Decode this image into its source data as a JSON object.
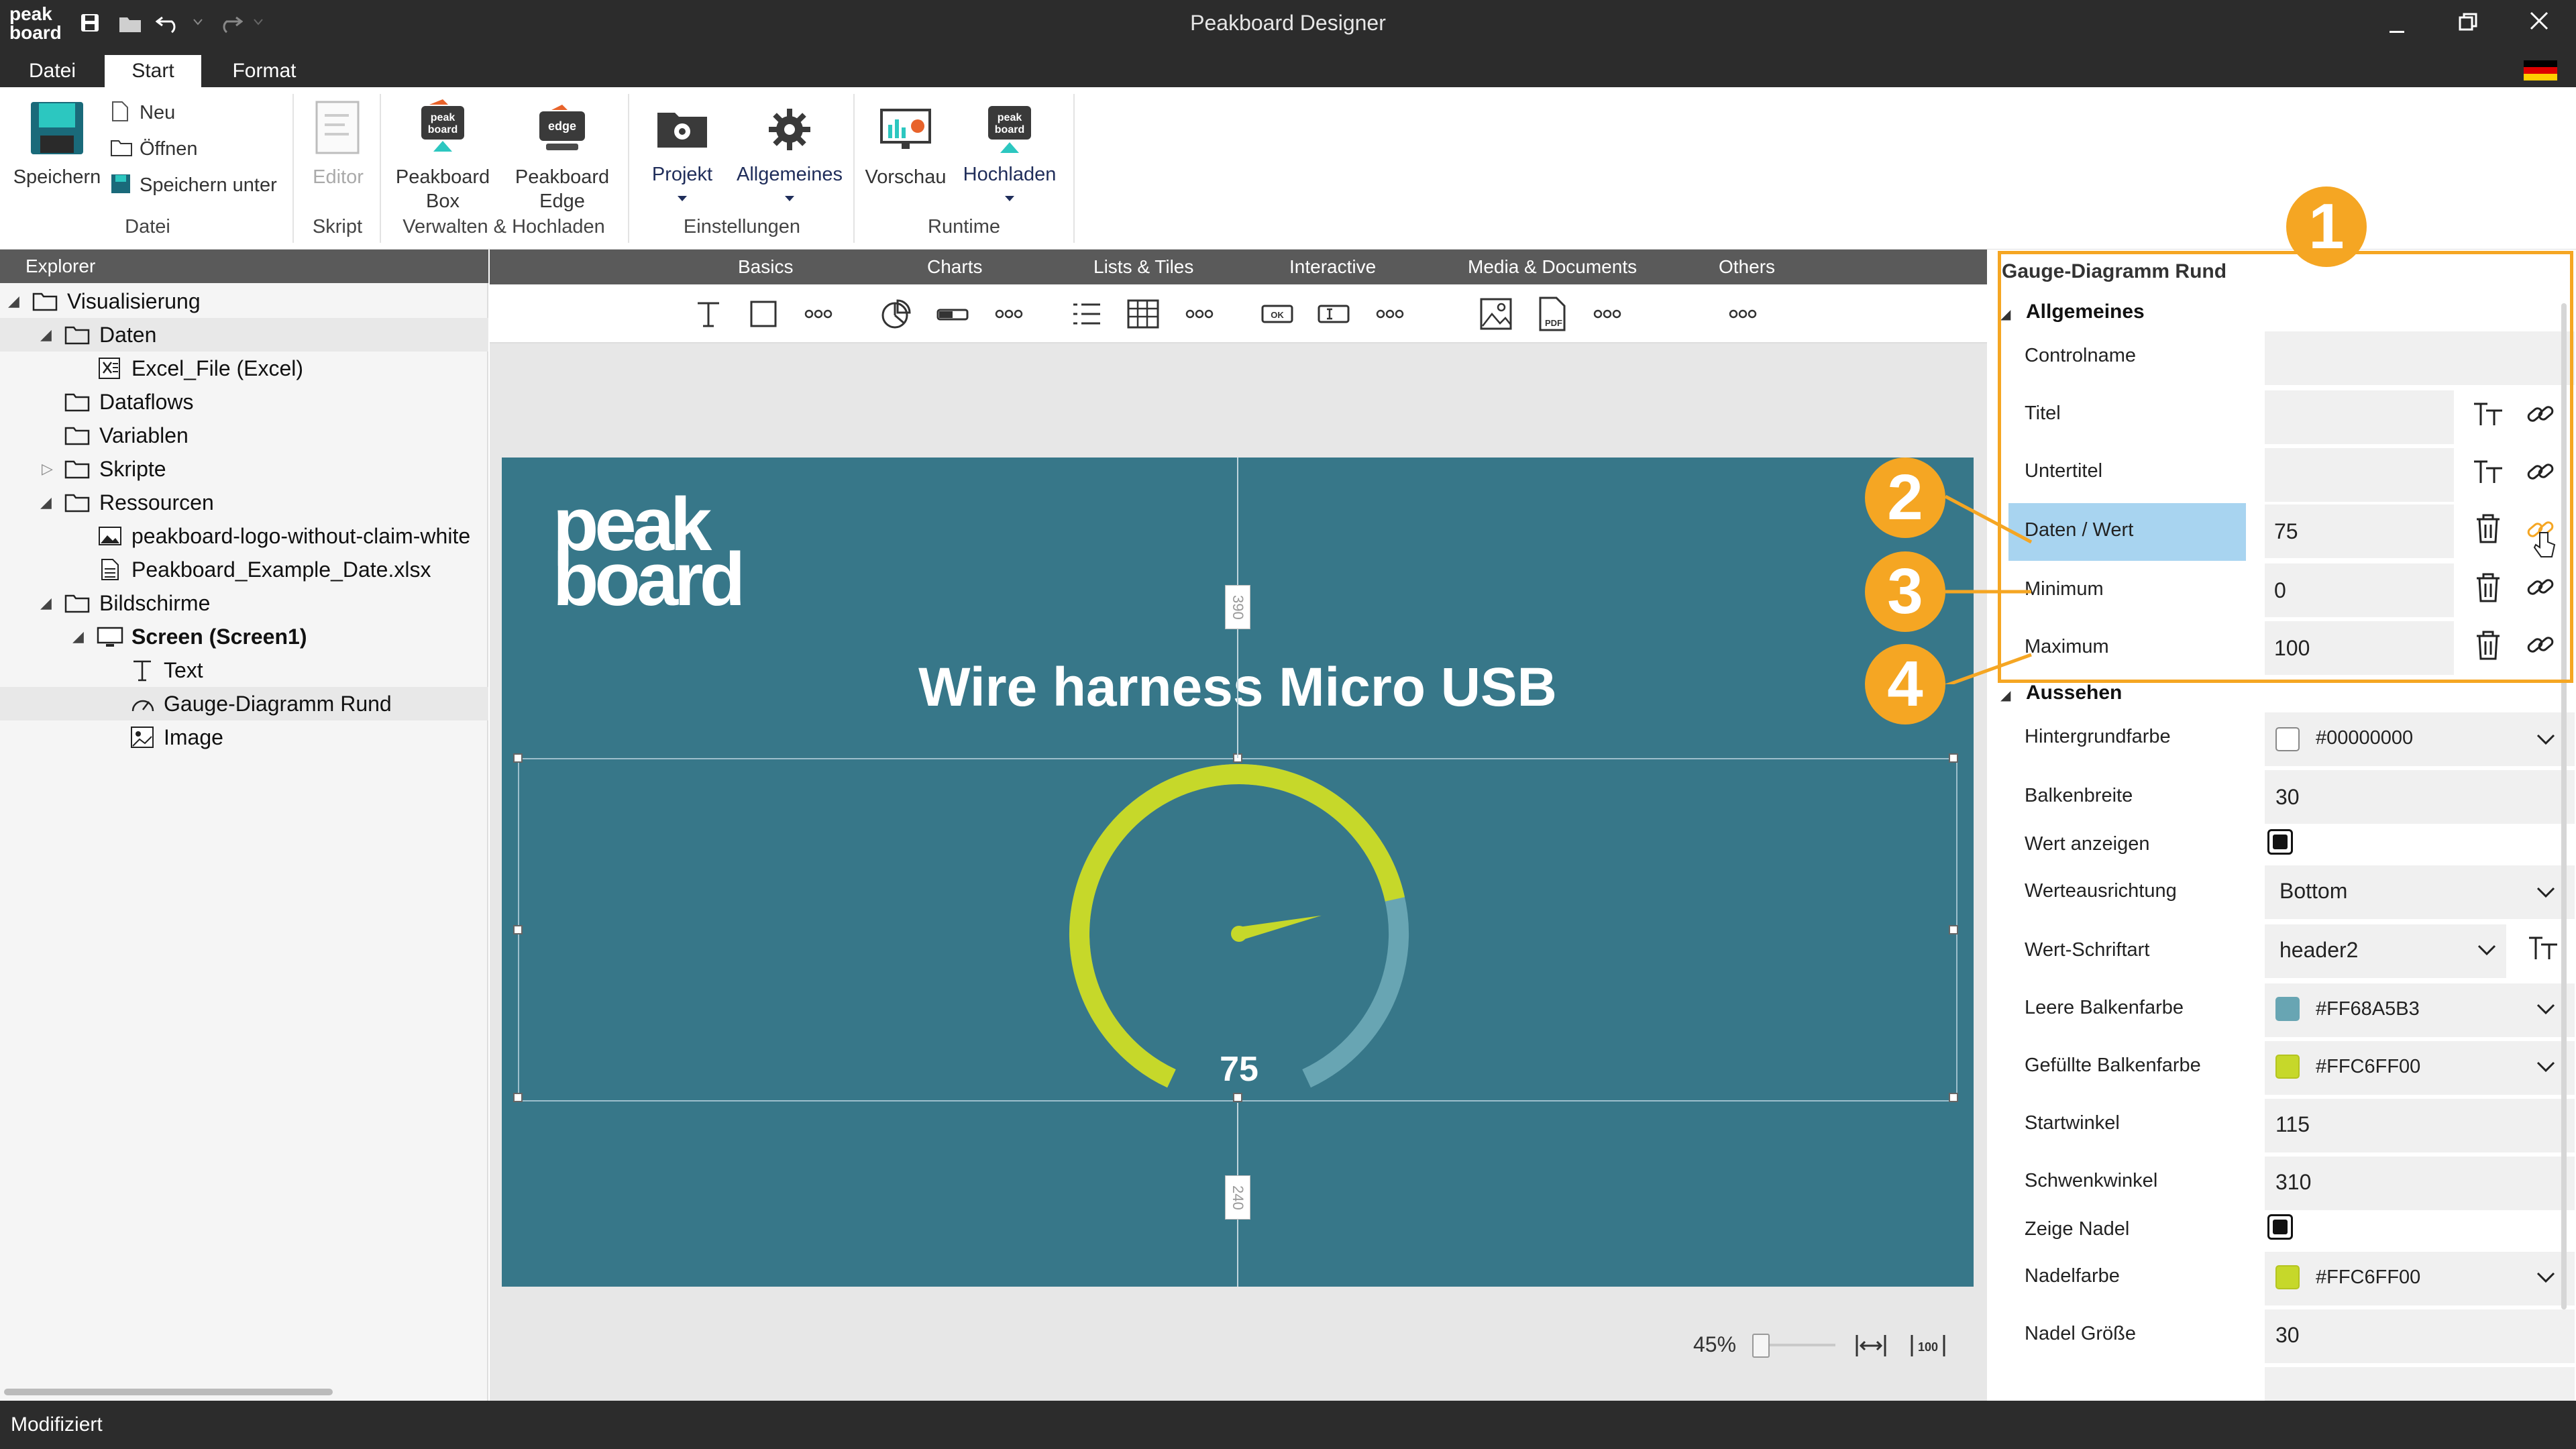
{
  "window": {
    "title": "Peakboard Designer",
    "logo_text": "peak board",
    "flag": "german-flag"
  },
  "menu": {
    "tabs": [
      "Datei",
      "Start",
      "Format"
    ],
    "active": "Start"
  },
  "ribbon": {
    "save": "Speichern",
    "new": "Neu",
    "open": "Öffnen",
    "save_as": "Speichern unter",
    "editor": "Editor",
    "peakboard_box_1": "Peakboard",
    "peakboard_box_2": "Box",
    "peakboard_edge_1": "Peakboard",
    "peakboard_edge_2": "Edge",
    "project": "Projekt",
    "general": "Allgemeines",
    "preview": "Vorschau",
    "upload": "Hochladen",
    "groups": {
      "file": "Datei",
      "script": "Skript",
      "manage": "Verwalten & Hochladen",
      "settings": "Einstellungen",
      "runtime": "Runtime"
    }
  },
  "explorer": {
    "header": "Explorer",
    "items": [
      {
        "label": "Visualisierung"
      },
      {
        "label": "Daten"
      },
      {
        "label": "Excel_File (Excel)"
      },
      {
        "label": "Dataflows"
      },
      {
        "label": "Variablen"
      },
      {
        "label": "Skripte"
      },
      {
        "label": "Ressourcen"
      },
      {
        "label": "peakboard-logo-without-claim-white"
      },
      {
        "label": "Peakboard_Example_Date.xlsx"
      },
      {
        "label": "Bildschirme"
      },
      {
        "label": "Screen (Screen1)"
      },
      {
        "label": "Text"
      },
      {
        "label": "Gauge-Diagramm Rund"
      },
      {
        "label": "Image"
      }
    ]
  },
  "toolbox": {
    "categories": [
      "Basics",
      "Charts",
      "Lists & Tiles",
      "Interactive",
      "Media & Documents",
      "Others"
    ],
    "more": "ooo",
    "ok_label": "OK",
    "pdf_label": "PDF"
  },
  "canvas": {
    "logo_line1": "peak",
    "logo_line2": "board",
    "heading": "Wire harness Micro USB",
    "gauge_value": "75",
    "gauge": {
      "value": 75,
      "min": 0,
      "max": 100,
      "start_angle": 115,
      "sweep_angle": 310
    },
    "ruler_top": "390",
    "ruler_bottom": "240",
    "zoom": "45%",
    "fit_label": "100"
  },
  "properties": {
    "title": "Gauge-Diagramm Rund",
    "general_section": "Allgemeines",
    "appearance_section": "Aussehen",
    "rows": {
      "controlname": {
        "label": "Controlname",
        "value": ""
      },
      "titel": {
        "label": "Titel",
        "value": ""
      },
      "untertitel": {
        "label": "Untertitel",
        "value": ""
      },
      "daten": {
        "label": "Daten / Wert",
        "value": "75"
      },
      "minimum": {
        "label": "Minimum",
        "value": "0"
      },
      "maximum": {
        "label": "Maximum",
        "value": "100"
      },
      "hintergrund": {
        "label": "Hintergrundfarbe",
        "value": "#00000000"
      },
      "balkenbreite": {
        "label": "Balkenbreite",
        "value": "30"
      },
      "wert_anzeigen": {
        "label": "Wert anzeigen"
      },
      "ausrichtung": {
        "label": "Werteausrichtung",
        "value": "Bottom"
      },
      "schrift": {
        "label": "Wert-Schriftart",
        "value": "header2"
      },
      "leere": {
        "label": "Leere Balkenfarbe",
        "value": "#FF68A5B3"
      },
      "gefuellte": {
        "label": "Gefüllte Balkenfarbe",
        "value": "#FFC6FF00"
      },
      "startwinkel": {
        "label": "Startwinkel",
        "value": "115"
      },
      "schwenkwinkel": {
        "label": "Schwenkwinkel",
        "value": "310"
      },
      "zeige_nadel": {
        "label": "Zeige Nadel"
      },
      "nadelfarbe": {
        "label": "Nadelfarbe",
        "value": "#FFC6FF00"
      },
      "nadel_groesse": {
        "label": "Nadel Größe",
        "value": "30"
      }
    }
  },
  "callouts": [
    "1",
    "2",
    "3",
    "4"
  ],
  "status": "Modifiziert",
  "colors": {
    "accent": "#f5a623",
    "screen_bg": "#377789",
    "gauge_filled": "#c6d82a",
    "gauge_empty": "#68a5b3",
    "selection_row": "#a8d4f0"
  }
}
